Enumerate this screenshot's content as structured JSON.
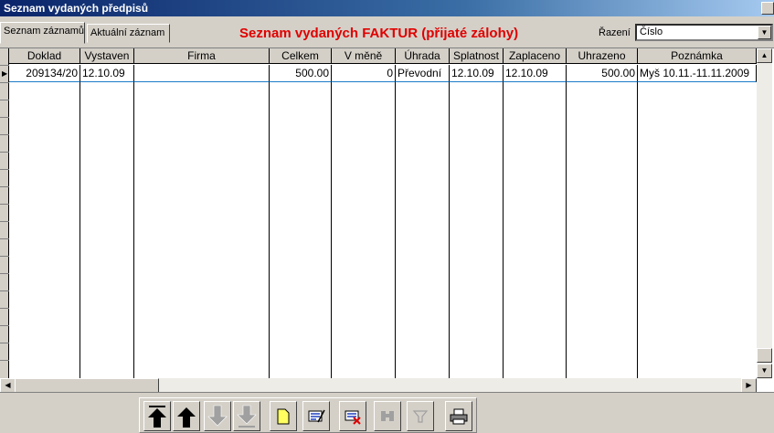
{
  "window": {
    "title": "Seznam vydaných předpisů"
  },
  "tabs": [
    {
      "label": "Seznam záznamů"
    },
    {
      "label": "Aktuální záznam"
    }
  ],
  "heading": "Seznam vydaných FAKTUR (přijaté zálohy)",
  "sort": {
    "label": "Řazení",
    "value": "Číslo"
  },
  "columns": [
    "Doklad",
    "Vystaven",
    "Firma",
    "Celkem",
    "V měně",
    "Úhrada",
    "Splatnost",
    "Zaplaceno",
    "Uhrazeno",
    "Poznámka"
  ],
  "rows": [
    {
      "doklad": "209134/20",
      "vystaven": "12.10.09",
      "firma": "",
      "celkem": "500.00",
      "v_mene": "0",
      "uhrada": "Převodní",
      "splatnost": "12.10.09",
      "zaplaceno": "12.10.09",
      "uhrazeno": "500.00",
      "poznamka": "Myš 10.11.-11.11.2009"
    }
  ],
  "toolbar": {
    "buttons": [
      {
        "icon": "first-record-arrow-icon",
        "enabled": true
      },
      {
        "icon": "previous-record-arrow-icon",
        "enabled": true
      },
      {
        "icon": "next-record-arrow-icon",
        "enabled": false
      },
      {
        "icon": "last-record-arrow-icon",
        "enabled": false
      },
      {
        "icon": "new-record-icon",
        "enabled": true
      },
      {
        "icon": "edit-record-icon",
        "enabled": true
      },
      {
        "icon": "delete-record-icon",
        "enabled": true
      },
      {
        "icon": "search-binoculars-icon",
        "enabled": false
      },
      {
        "icon": "filter-funnel-icon",
        "enabled": false
      },
      {
        "icon": "print-icon",
        "enabled": true
      }
    ]
  },
  "colors": {
    "title_start": "#0a246a",
    "heading": "#e00000",
    "face": "#d4d0c8",
    "selection_line": "#1c7cc8"
  }
}
